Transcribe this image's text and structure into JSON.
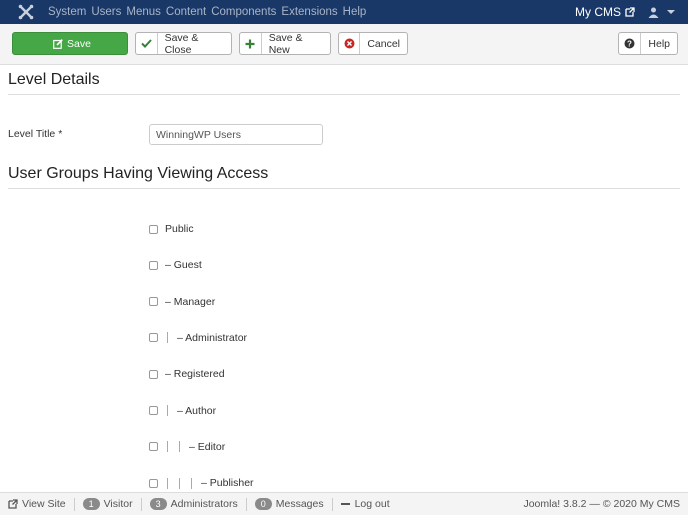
{
  "navbar": {
    "menu": [
      "System",
      "Users",
      "Menus",
      "Content",
      "Components",
      "Extensions",
      "Help"
    ],
    "site_name": "My CMS"
  },
  "toolbar": {
    "save_label": "Save",
    "save_close_label": "Save & Close",
    "save_new_label": "Save & New",
    "cancel_label": "Cancel",
    "help_label": "Help"
  },
  "form": {
    "section_title": "Level Details",
    "level_title_label": "Level Title *",
    "level_title_value": "WinningWP Users",
    "groups_title": "User Groups Having Viewing Access",
    "groups": [
      {
        "label": "Public",
        "depth": 0,
        "checked": false
      },
      {
        "label": "– Guest",
        "depth": 0,
        "checked": false
      },
      {
        "label": "– Manager",
        "depth": 0,
        "checked": false
      },
      {
        "label": "– Administrator",
        "depth": 1,
        "checked": false
      },
      {
        "label": "– Registered",
        "depth": 0,
        "checked": false
      },
      {
        "label": "– Author",
        "depth": 1,
        "checked": false
      },
      {
        "label": "– Editor",
        "depth": 2,
        "checked": false
      },
      {
        "label": "– Publisher",
        "depth": 3,
        "checked": false
      }
    ]
  },
  "footer": {
    "view_site": "View Site",
    "visitor_count": "1",
    "visitor_label": "Visitor",
    "admin_count": "3",
    "admin_label": "Administrators",
    "message_count": "0",
    "message_label": "Messages",
    "logout": "Log out",
    "version": "Joomla! 3.8.2 — © 2020 My CMS"
  },
  "colors": {
    "navbar_bg": "#1a3867",
    "save_green": "#45a745",
    "cancel_red": "#c52827"
  }
}
